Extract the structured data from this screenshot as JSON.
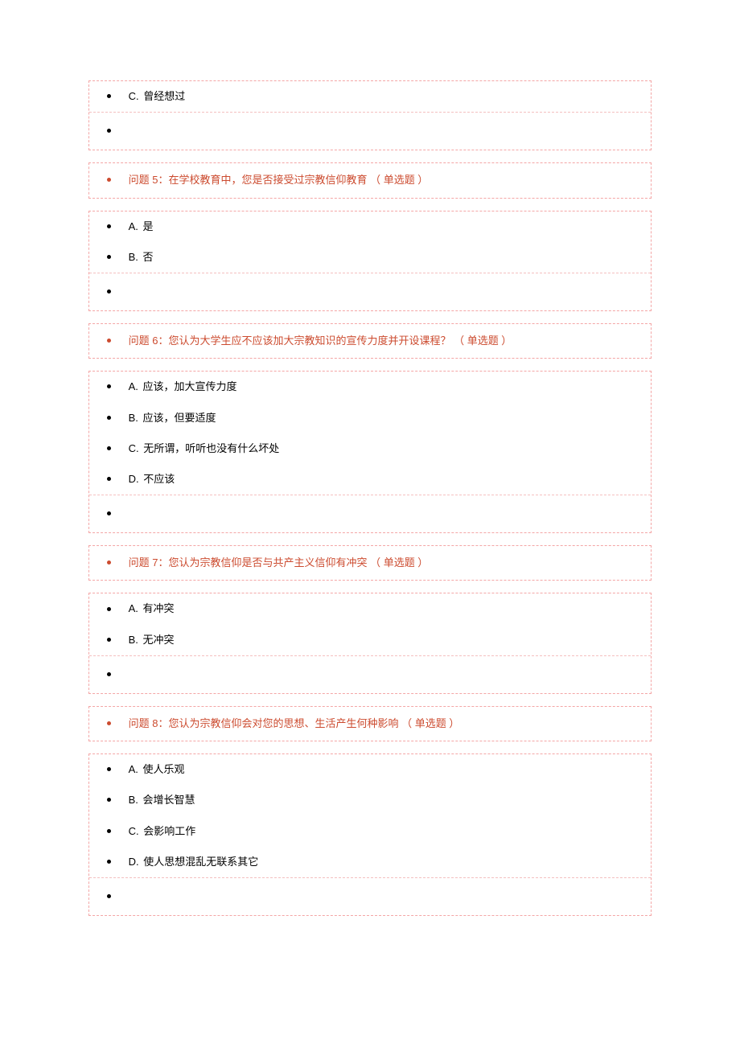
{
  "partial": {
    "options": [
      {
        "letter": "C.",
        "text": "曾经想过"
      }
    ]
  },
  "questions": [
    {
      "title": "问题 5：在学校教育中，您是否接受过宗教信仰教育 （ 单选题 ）",
      "options": [
        {
          "letter": "A.",
          "text": "是"
        },
        {
          "letter": "B.",
          "text": "否"
        }
      ]
    },
    {
      "title": "问题 6：您认为大学生应不应该加大宗教知识的宣传力度并开设课程？ （ 单选题 ）",
      "options": [
        {
          "letter": "A.",
          "text": "应该，加大宣传力度"
        },
        {
          "letter": "B.",
          "text": "应该，但要适度"
        },
        {
          "letter": "C.",
          "text": "无所谓，听听也没有什么坏处"
        },
        {
          "letter": "D.",
          "text": "不应该"
        }
      ]
    },
    {
      "title": "问题 7：您认为宗教信仰是否与共产主义信仰有冲突 （ 单选题 ）",
      "options": [
        {
          "letter": "A.",
          "text": "有冲突"
        },
        {
          "letter": "B.",
          "text": "无冲突"
        }
      ]
    },
    {
      "title": "问题 8：您认为宗教信仰会对您的思想、生活产生何种影响 （ 单选题 ）",
      "options": [
        {
          "letter": "A.",
          "text": "使人乐观"
        },
        {
          "letter": "B.",
          "text": "会增长智慧"
        },
        {
          "letter": "C.",
          "text": "会影响工作"
        },
        {
          "letter": "D.",
          "text": "使人思想混乱无联系其它"
        }
      ]
    }
  ]
}
